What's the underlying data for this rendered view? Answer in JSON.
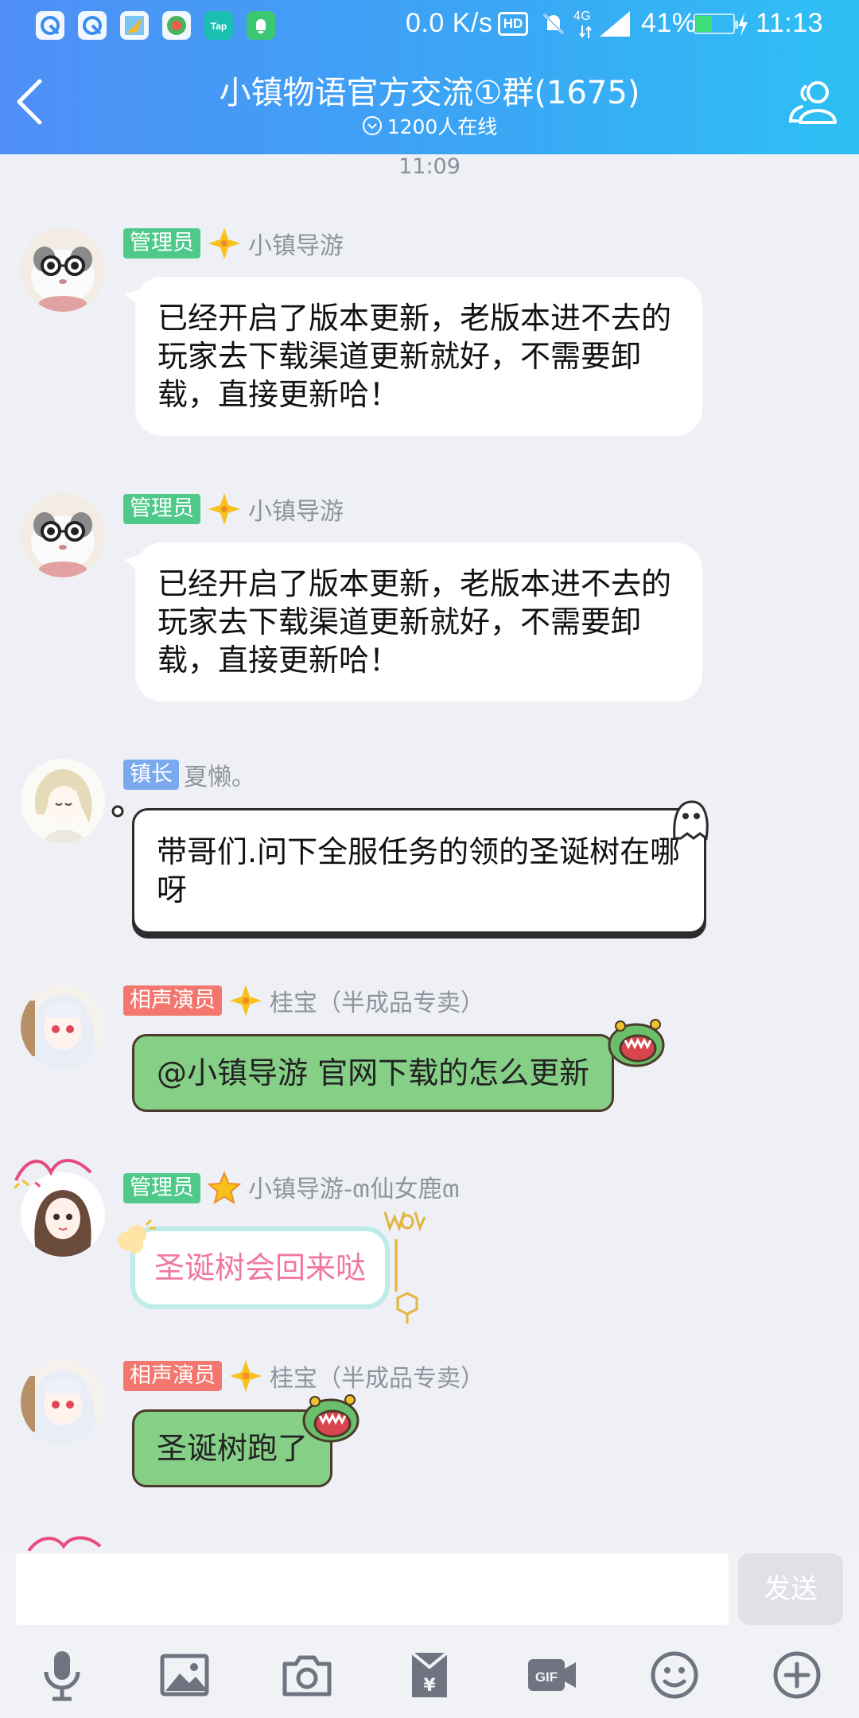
{
  "status_bar": {
    "speed": "0.0 K/s",
    "network": "4G",
    "battery_percent": "41%",
    "battery_level": 0.41,
    "time": "11:13",
    "icons": [
      "browser-icon",
      "browser-icon",
      "map-icon",
      "app-icon",
      "taptap-icon",
      "bell-icon"
    ]
  },
  "header": {
    "title": "小镇物语官方交流①群(1675)",
    "online": "1200人在线"
  },
  "chat": {
    "timestamp": "11:09",
    "messages": [
      {
        "badge": "管理员",
        "sender": "小镇导游",
        "text": "已经开启了版本更新，老版本进不去的玩家去下载渠道更新就好，不需要卸载，直接更新哈！"
      },
      {
        "badge": "管理员",
        "sender": "小镇导游",
        "text": "已经开启了版本更新，老版本进不去的玩家去下载渠道更新就好，不需要卸载，直接更新哈！"
      },
      {
        "badge": "镇长",
        "sender": "夏懒。",
        "text": "带哥们.问下全服任务的领的圣诞树在哪呀"
      },
      {
        "badge": "相声演员",
        "sender": "桂宝（半成品专卖）",
        "text": "@小镇导游 官网下载的怎么更新"
      },
      {
        "badge": "管理员",
        "sender": "小镇导游-ຓ仙女鹿ຓ",
        "text": "圣诞树会回来哒"
      },
      {
        "badge": "相声演员",
        "sender": "桂宝（半成品专卖）",
        "text": "圣诞树跑了"
      }
    ]
  },
  "input": {
    "placeholder": "",
    "send_label": "发送"
  },
  "toolbar": {
    "gif_label": "GIF"
  }
}
